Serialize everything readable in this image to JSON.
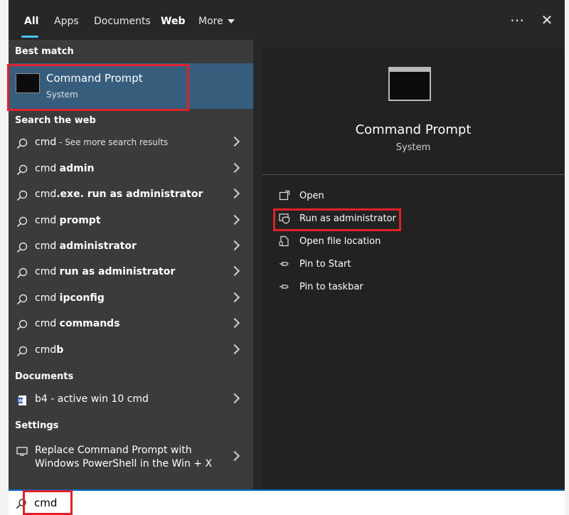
{
  "tabs": [
    {
      "label": "All",
      "active": true
    },
    {
      "label": "Apps"
    },
    {
      "label": "Documents"
    },
    {
      "label": "Web"
    },
    {
      "label": "More"
    }
  ],
  "top_icons": {
    "more_options": "ellipsis-icon",
    "close": "close-icon"
  },
  "best_match": {
    "heading": "Best match",
    "title": "Command Prompt",
    "subtitle": "System",
    "icon": "terminal-icon"
  },
  "web": {
    "heading": "Search the web",
    "items": [
      {
        "prefix": "cmd",
        "bold": "",
        "hint": " - See more search results"
      },
      {
        "prefix": "cmd ",
        "bold": "admin",
        "hint": ""
      },
      {
        "prefix": "cmd",
        "bold": ".exe. run as administrator",
        "hint": ""
      },
      {
        "prefix": "cmd ",
        "bold": "prompt",
        "hint": ""
      },
      {
        "prefix": "cmd ",
        "bold": "administrator",
        "hint": ""
      },
      {
        "prefix": "cmd ",
        "bold": "run as administrator",
        "hint": ""
      },
      {
        "prefix": "cmd ",
        "bold": "ipconfig",
        "hint": ""
      },
      {
        "prefix": "cmd ",
        "bold": "commands",
        "hint": ""
      },
      {
        "prefix": "cmd",
        "bold": "b",
        "hint": ""
      }
    ]
  },
  "documents": {
    "heading": "Documents",
    "items": [
      {
        "label": "b4 - active win 10 cmd",
        "icon": "word-document-icon"
      }
    ]
  },
  "settings": {
    "heading": "Settings",
    "items": [
      {
        "line1": "Replace Command Prompt with",
        "line2": "Windows PowerShell in the Win + X",
        "icon": "monitor-icon"
      }
    ]
  },
  "preview": {
    "title": "Command Prompt",
    "subtitle": "System",
    "actions": [
      {
        "label": "Open",
        "icon": "open-icon"
      },
      {
        "label": "Run as administrator",
        "icon": "shield-icon"
      },
      {
        "label": "Open file location",
        "icon": "folder-icon"
      },
      {
        "label": "Pin to Start",
        "icon": "pin-icon"
      },
      {
        "label": "Pin to taskbar",
        "icon": "pin-icon"
      }
    ]
  },
  "search": {
    "value": "cmd",
    "icon": "search-icon"
  },
  "highlight_color": "#e0202a",
  "accent_color": "#4cc2ff"
}
